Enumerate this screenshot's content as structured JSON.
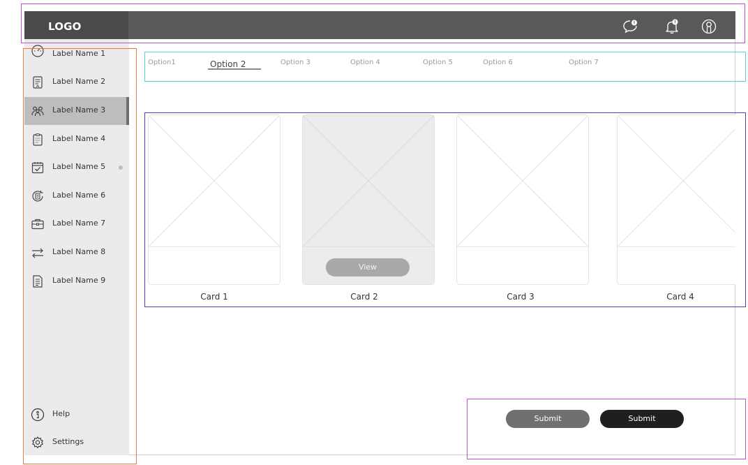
{
  "header": {
    "logo": "LOGO",
    "icons": [
      "chat-icon",
      "bell-icon",
      "user-icon"
    ]
  },
  "sidebar": {
    "items": [
      {
        "label": "Label Name 1",
        "icon": "gauge-icon"
      },
      {
        "label": "Label Name 2",
        "icon": "document-icon"
      },
      {
        "label": "Label Name 3",
        "icon": "users-icon",
        "active": true
      },
      {
        "label": "Label Name 4",
        "icon": "clipboard-icon"
      },
      {
        "label": "Label Name 5",
        "icon": "calendar-check-icon",
        "dot": true
      },
      {
        "label": "Label Name 6",
        "icon": "refresh-document-icon"
      },
      {
        "label": "Label Name 7",
        "icon": "briefcase-icon"
      },
      {
        "label": "Label Name 8",
        "icon": "transfer-arrows-icon"
      },
      {
        "label": "Label Name 9",
        "icon": "file-list-icon"
      }
    ],
    "footer": [
      {
        "label": "Help",
        "icon": "help-icon"
      },
      {
        "label": "Settings",
        "icon": "gear-icon"
      }
    ]
  },
  "tabs": {
    "items": [
      "Option1",
      "Option 2",
      "Option 3",
      "Option 4",
      "Option 5",
      "Option 6",
      "Option 7"
    ],
    "active_index": 1
  },
  "cards": [
    {
      "label": "Card 1"
    },
    {
      "label": "Card 2",
      "button": "View",
      "selected": true
    },
    {
      "label": "Card 3"
    },
    {
      "label": "Card 4"
    }
  ],
  "actions": {
    "secondary_label": "Submit",
    "primary_label": "Submit"
  },
  "colors": {
    "header": "#595959",
    "sidebar": "#ebebeb",
    "active_item": "#bdbdbd",
    "primary_button": "#1f1f1f",
    "secondary_button": "#707070"
  }
}
